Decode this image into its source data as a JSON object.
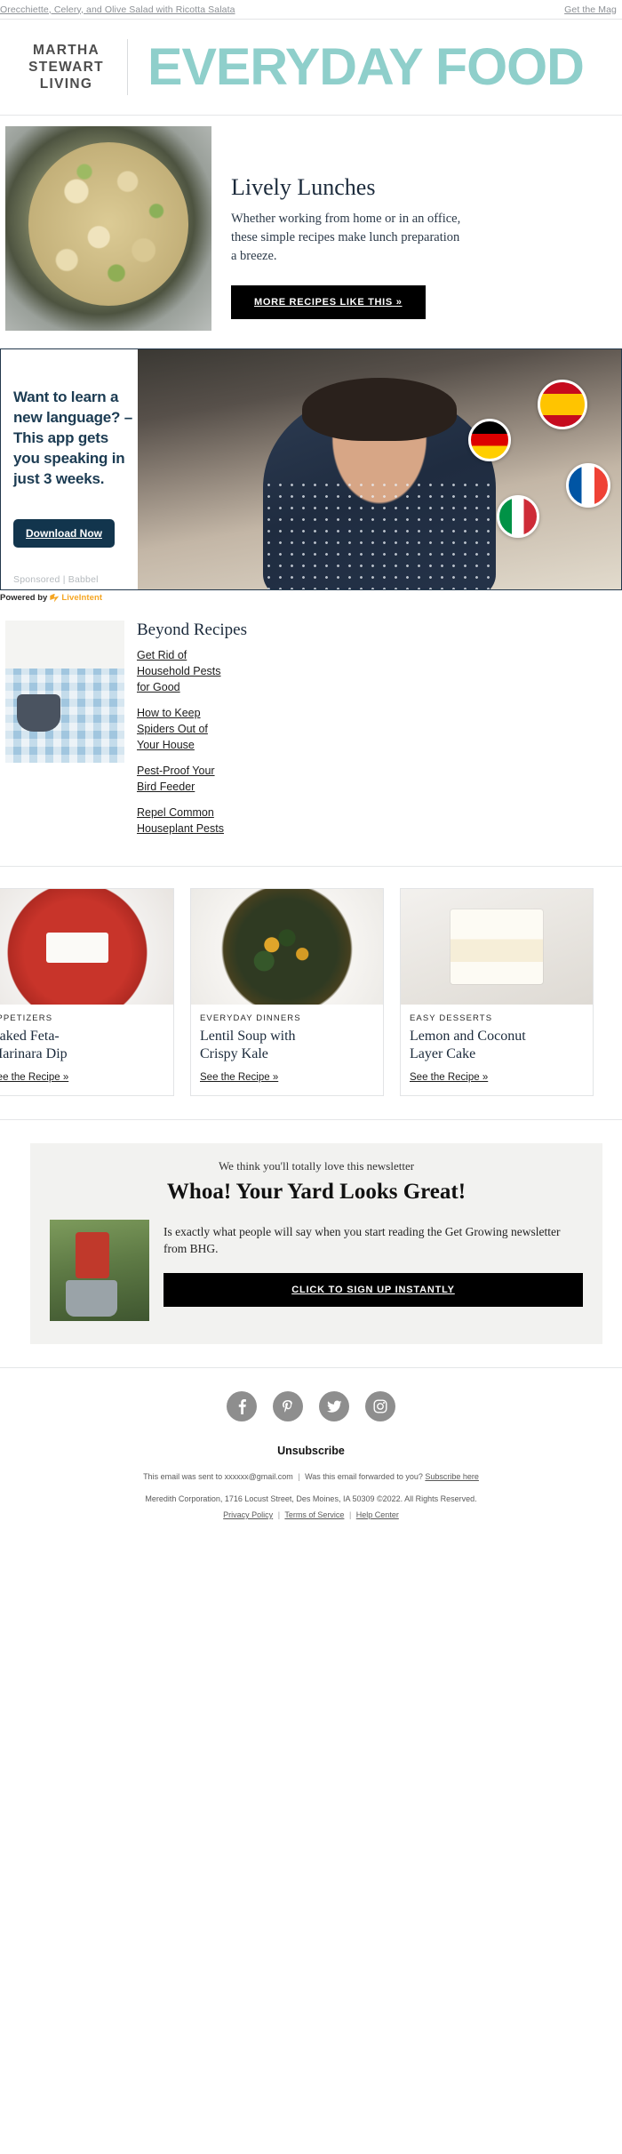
{
  "preheader": {
    "left_link": "Orecchiette, Celery, and Olive Salad with Ricotta Salata",
    "right_link": "Get the Mag"
  },
  "masthead": {
    "brand_line1": "MARTHA",
    "brand_line2": "STEWART",
    "brand_line3": "LIVING",
    "title": "EVERYDAY FOOD",
    "title_color": "#8fcfcb"
  },
  "hero": {
    "heading": "Lively Lunches",
    "body_line1": "Whether working from home or in an office,",
    "body_line2": "these simple recipes make lunch preparation",
    "body_line3": "a breeze.",
    "button_label": "MORE RECIPES LIKE THIS »"
  },
  "ad": {
    "headline": "Want to learn a new language? – This app gets you speaking in just 3 weeks.",
    "button_label": "Download Now",
    "sponsor_label": "Sponsored | Babbel",
    "flags": [
      "spain-flag",
      "germany-flag",
      "france-flag",
      "italy-flag"
    ],
    "powered_by_prefix": "Powered by",
    "powered_by_brand": "LiveIntent",
    "brand_color": "#f5a623",
    "accent_color": "#12354d"
  },
  "beyond": {
    "heading": "Beyond Recipes",
    "links": [
      "Get Rid of Household Pests for Good",
      "How to Keep Spiders Out of Your House",
      "Pest-Proof Your Bird Feeder",
      "Repel Common Houseplant Pests"
    ]
  },
  "cards": [
    {
      "kicker": "APPETIZERS",
      "title_line1": "Baked Feta-",
      "title_line2": "Marinara Dip",
      "link": "See the Recipe »"
    },
    {
      "kicker": "EVERYDAY DINNERS",
      "title_line1": "Lentil Soup with",
      "title_line2": "Crispy Kale",
      "link": "See the Recipe »"
    },
    {
      "kicker": "EASY DESSERTS",
      "title_line1": "Lemon and Coconut",
      "title_line2": "Layer Cake",
      "link": "See the Recipe »"
    }
  ],
  "promo": {
    "kicker": "We think you'll totally love this newsletter",
    "heading": "Whoa! Your Yard Looks Great!",
    "body": "Is exactly what people will say when you start reading the Get Growing newsletter from BHG.",
    "button_label": "CLICK TO SIGN UP INSTANTLY"
  },
  "footer": {
    "social": [
      {
        "name": "facebook-icon",
        "glyph": "f"
      },
      {
        "name": "pinterest-icon",
        "glyph": "P"
      },
      {
        "name": "twitter-icon",
        "glyph": "t"
      },
      {
        "name": "instagram-icon",
        "glyph": "□"
      }
    ],
    "unsubscribe": "Unsubscribe",
    "sent_to": "This email was sent to xxxxxx@gmail.com",
    "forwarded_question": "Was this email forwarded to you?",
    "subscribe_link": "Subscribe here",
    "company": "Meredith Corporation, 1716 Locust Street, Des Moines, IA 50309 ©2022. All Rights Reserved.",
    "privacy": "Privacy Policy",
    "terms": "Terms of Service",
    "help": "Help Center"
  }
}
